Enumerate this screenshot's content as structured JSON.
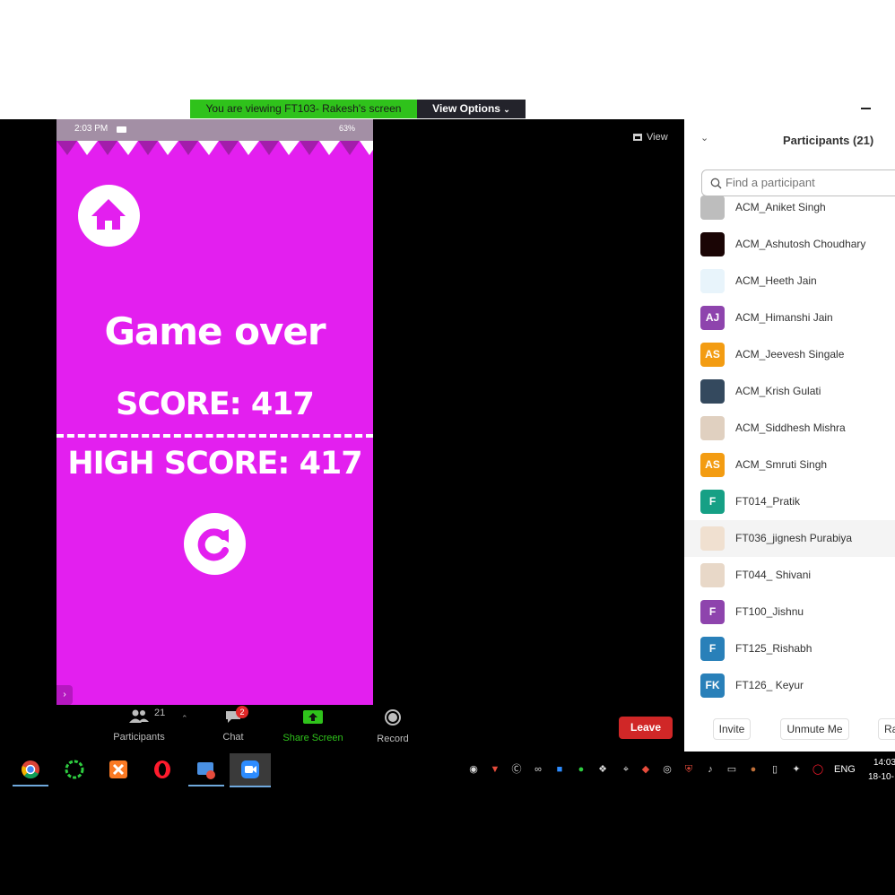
{
  "banner": {
    "viewing": "You are viewing FT103- Rakesh's screen",
    "view_options": "View Options"
  },
  "view_label": "View",
  "phone": {
    "time": "2:03 PM",
    "battery": "63%",
    "game_over": "Game over",
    "score": "SCORE: 417",
    "high_score": "HIGH SCORE: 417"
  },
  "toolbar": {
    "participants_label": "Participants",
    "participants_count": "21",
    "chat_label": "Chat",
    "chat_badge": "2",
    "share_label": "Share Screen",
    "record_label": "Record",
    "leave_label": "Leave"
  },
  "panel": {
    "title": "Participants (21)",
    "search_placeholder": "Find a participant",
    "participants": [
      {
        "name": "ACM_Aniket Singh",
        "initials": "",
        "color": "#bdbdbd"
      },
      {
        "name": "ACM_Ashutosh Choudhary",
        "initials": "",
        "color": "#1a0505"
      },
      {
        "name": "ACM_Heeth Jain",
        "initials": "",
        "color": "#e8f4fb"
      },
      {
        "name": "ACM_Himanshi Jain",
        "initials": "AJ",
        "color": "#8e44ad"
      },
      {
        "name": "ACM_Jeevesh Singale",
        "initials": "AS",
        "color": "#f39c12"
      },
      {
        "name": "ACM_Krish Gulati",
        "initials": "",
        "color": "#34495e"
      },
      {
        "name": "ACM_Siddhesh Mishra",
        "initials": "",
        "color": "#e0d0c0"
      },
      {
        "name": "ACM_Smruti Singh",
        "initials": "AS",
        "color": "#f39c12"
      },
      {
        "name": "FT014_Pratik",
        "initials": "F",
        "color": "#16a085"
      },
      {
        "name": "FT036_jignesh Purabiya",
        "initials": "",
        "color": "#f0e0d0"
      },
      {
        "name": "FT044_ Shivani",
        "initials": "",
        "color": "#e8d8c8"
      },
      {
        "name": "FT100_Jishnu",
        "initials": "F",
        "color": "#8e44ad"
      },
      {
        "name": "FT125_Rishabh",
        "initials": "F",
        "color": "#2980b9"
      },
      {
        "name": "FT126_ Keyur",
        "initials": "FK",
        "color": "#2980b9"
      }
    ],
    "invite_label": "Invite",
    "unmute_label": "Unmute Me",
    "more_label": "Ra"
  },
  "taskbar": {
    "language": "ENG",
    "time": "14:03",
    "date": "18-10-"
  },
  "colors": {
    "phone_bg": "#e31fef",
    "share_green": "#2fc21b",
    "leave_red": "#d02727"
  }
}
